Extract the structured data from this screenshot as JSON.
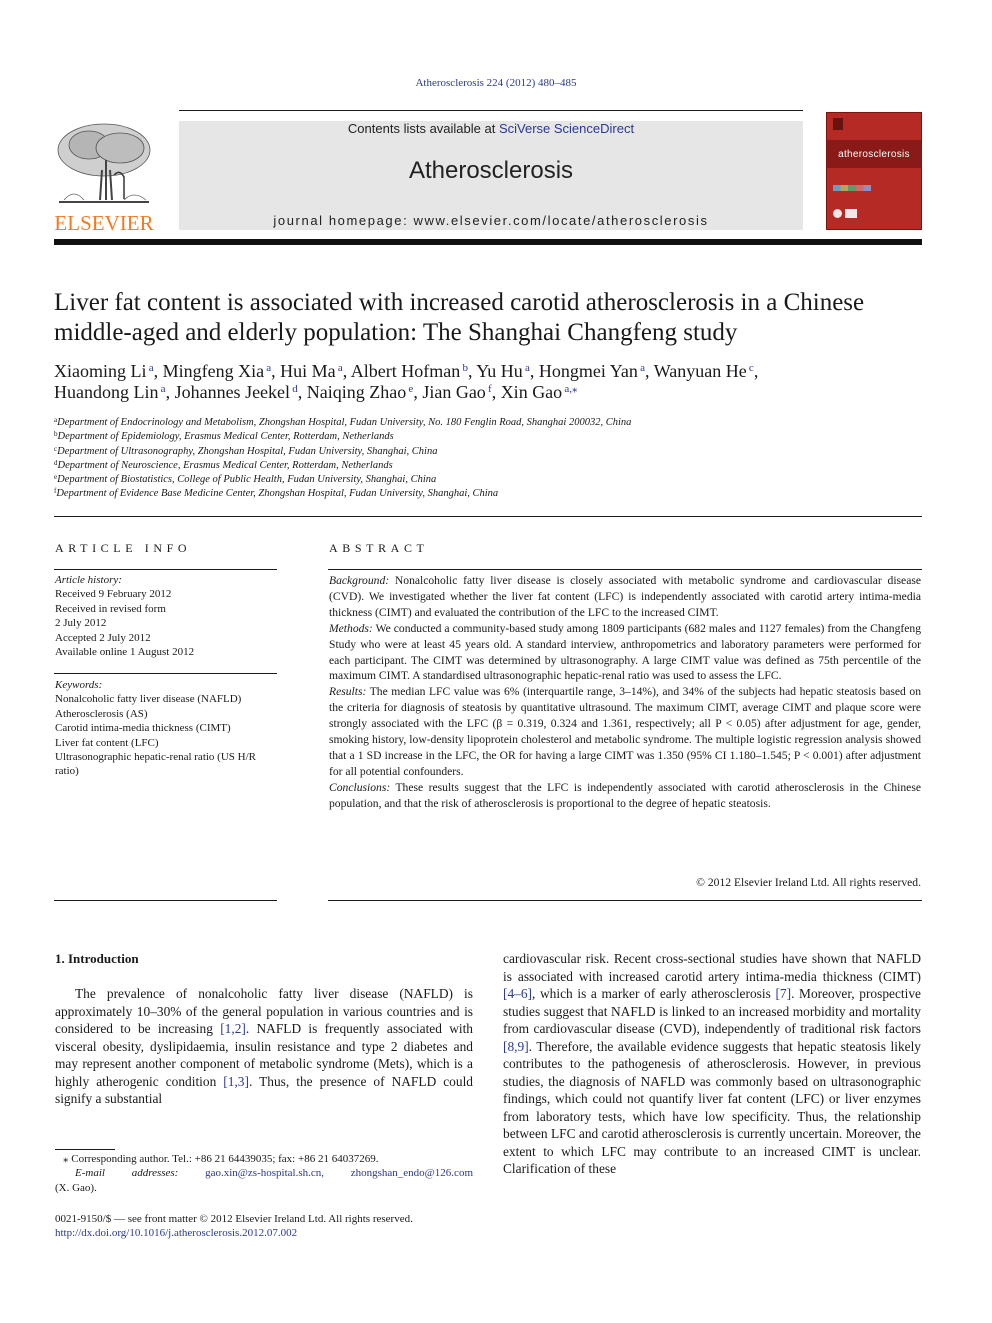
{
  "header": {
    "citation": "Atherosclerosis 224 (2012) 480–485",
    "contents_prefix": "Contents lists available at ",
    "contents_link": "SciVerse ScienceDirect",
    "journal_name": "Atherosclerosis",
    "homepage_prefix": "journal homepage: ",
    "homepage_url": "www.elsevier.com/locate/atherosclerosis",
    "publisher_logo_text": "ELSEVIER",
    "cover_title": "atherosclerosis",
    "colors": {
      "elsevier_orange": "#f47a20",
      "cover_red": "#b52a25",
      "link_blue": "#2b3990",
      "banner_gray": "#e6e6e6"
    }
  },
  "article": {
    "title": "Liver fat content is associated with increased carotid atherosclerosis in a Chinese middle-aged and elderly population: The Shanghai Changfeng study",
    "authors": [
      {
        "name": "Xiaoming Li",
        "aff": "a",
        "sep": ", "
      },
      {
        "name": "Mingfeng Xia",
        "aff": "a",
        "sep": ", "
      },
      {
        "name": "Hui Ma",
        "aff": "a",
        "sep": ", "
      },
      {
        "name": "Albert Hofman",
        "aff": "b",
        "sep": ", "
      },
      {
        "name": "Yu Hu",
        "aff": "a",
        "sep": ", "
      },
      {
        "name": "Hongmei Yan",
        "aff": "a",
        "sep": ", "
      },
      {
        "name": "Wanyuan He",
        "aff": "c",
        "sep": ", "
      },
      {
        "name": "Huandong Lin",
        "aff": "a",
        "sep": ", "
      },
      {
        "name": "Johannes Jeekel",
        "aff": "d",
        "sep": ", "
      },
      {
        "name": "Naiqing Zhao",
        "aff": "e",
        "sep": ", "
      },
      {
        "name": "Jian Gao",
        "aff": "f",
        "sep": ", "
      },
      {
        "name": "Xin Gao",
        "aff": "a,⁎",
        "sep": ""
      }
    ],
    "affiliations": [
      {
        "key": "a",
        "text": "Department of Endocrinology and Metabolism, Zhongshan Hospital, Fudan University, No. 180 Fenglin Road, Shanghai 200032, China"
      },
      {
        "key": "b",
        "text": "Department of Epidemiology, Erasmus Medical Center, Rotterdam, Netherlands"
      },
      {
        "key": "c",
        "text": "Department of Ultrasonography, Zhongshan Hospital, Fudan University, Shanghai, China"
      },
      {
        "key": "d",
        "text": "Department of Neuroscience, Erasmus Medical Center, Rotterdam, Netherlands"
      },
      {
        "key": "e",
        "text": "Department of Biostatistics, College of Public Health, Fudan University, Shanghai, China"
      },
      {
        "key": "f",
        "text": "Department of Evidence Base Medicine Center, Zhongshan Hospital, Fudan University, Shanghai, China"
      }
    ]
  },
  "article_info": {
    "heading": "ARTICLE INFO",
    "history_label": "Article history:",
    "history": [
      "Received 9 February 2012",
      "Received in revised form",
      "2 July 2012",
      "Accepted 2 July 2012",
      "Available online 1 August 2012"
    ],
    "keywords_label": "Keywords:",
    "keywords": [
      "Nonalcoholic fatty liver disease (NAFLD)",
      "Atherosclerosis (AS)",
      "Carotid intima-media thickness (CIMT)",
      "Liver fat content (LFC)",
      "Ultrasonographic hepatic-renal ratio (US H/R ratio)"
    ]
  },
  "abstract": {
    "heading": "ABSTRACT",
    "sections": [
      {
        "label": "Background:",
        "text": " Nonalcoholic fatty liver disease is closely associated with metabolic syndrome and cardiovascular disease (CVD). We investigated whether the liver fat content (LFC) is independently associated with carotid artery intima-media thickness (CIMT) and evaluated the contribution of the LFC to the increased CIMT."
      },
      {
        "label": "Methods:",
        "text": " We conducted a community-based study among 1809 participants (682 males and 1127 females) from the Changfeng Study who were at least 45 years old. A standard interview, anthropometrics and laboratory parameters were performed for each participant. The CIMT was determined by ultrasonography. A large CIMT value was defined as 75th percentile of the maximum CIMT. A standardised ultrasonographic hepatic-renal ratio was used to assess the LFC."
      },
      {
        "label": "Results:",
        "text": " The median LFC value was 6% (interquartile range, 3–14%), and 34% of the subjects had hepatic steatosis based on the criteria for diagnosis of steatosis by quantitative ultrasound. The maximum CIMT, average CIMT and plaque score were strongly associated with the LFC (β = 0.319, 0.324 and 1.361, respectively; all P < 0.05) after adjustment for age, gender, smoking history, low-density lipoprotein cholesterol and metabolic syndrome. The multiple logistic regression analysis showed that a 1 SD increase in the LFC, the OR for having a large CIMT was 1.350 (95% CI 1.180–1.545; P < 0.001) after adjustment for all potential confounders."
      },
      {
        "label": "Conclusions:",
        "text": " These results suggest that the LFC is independently associated with carotid atherosclerosis in the Chinese population, and that the risk of atherosclerosis is proportional to the degree of hepatic steatosis."
      }
    ],
    "copyright": "© 2012 Elsevier Ireland Ltd. All rights reserved."
  },
  "body": {
    "section_heading": "1.  Introduction",
    "left_column": [
      {
        "t": "The prevalence of nonalcoholic fatty liver disease (NAFLD) is approximately 10–30% of the general population in various countries and is considered to be increasing "
      },
      {
        "ref": "[1,2]"
      },
      {
        "t": ". NAFLD is frequently associated with visceral obesity, dyslipidaemia, insulin resistance and type 2 diabetes and may represent another component of metabolic syndrome (Mets), which is a highly atherogenic condition "
      },
      {
        "ref": "[1,3]"
      },
      {
        "t": ". Thus, the presence of NAFLD could signify a substantial"
      }
    ],
    "right_column": [
      {
        "t": "cardiovascular risk. Recent cross-sectional studies have shown that NAFLD is associated with increased carotid artery intima-media thickness (CIMT) "
      },
      {
        "ref": "[4–6]"
      },
      {
        "t": ", which is a marker of early atherosclerosis "
      },
      {
        "ref": "[7]"
      },
      {
        "t": ". Moreover, prospective studies suggest that NAFLD is linked to an increased morbidity and mortality from cardiovascular disease (CVD), independently of traditional risk factors "
      },
      {
        "ref": "[8,9]"
      },
      {
        "t": ". Therefore, the available evidence suggests that hepatic steatosis likely contributes to the pathogenesis of atherosclerosis. However, in previous studies, the diagnosis of NAFLD was commonly based on ultrasonographic findings, which could not quantify liver fat content (LFC) or liver enzymes from laboratory tests, which have low specificity. Thus, the relationship between LFC and carotid atherosclerosis is currently uncertain. Moreover, the extent to which LFC may contribute to an increased CIMT is unclear. Clarification of these"
      }
    ]
  },
  "footnote": {
    "corresponding": "⁎ Corresponding author. Tel.: +86 21 64439035; fax: +86 21 64037269.",
    "email_label_1": "E-mail",
    "email_label_2": "addresses:",
    "email_1": "gao.xin@zs-hospital.sh.cn,",
    "email_2": "zhongshan_endo@126.com",
    "email_owner": "(X. Gao)."
  },
  "front_matter": {
    "issn_line": "0021-9150/$ — see front matter © 2012 Elsevier Ireland Ltd. All rights reserved.",
    "doi": "http://dx.doi.org/10.1016/j.atherosclerosis.2012.07.002"
  }
}
